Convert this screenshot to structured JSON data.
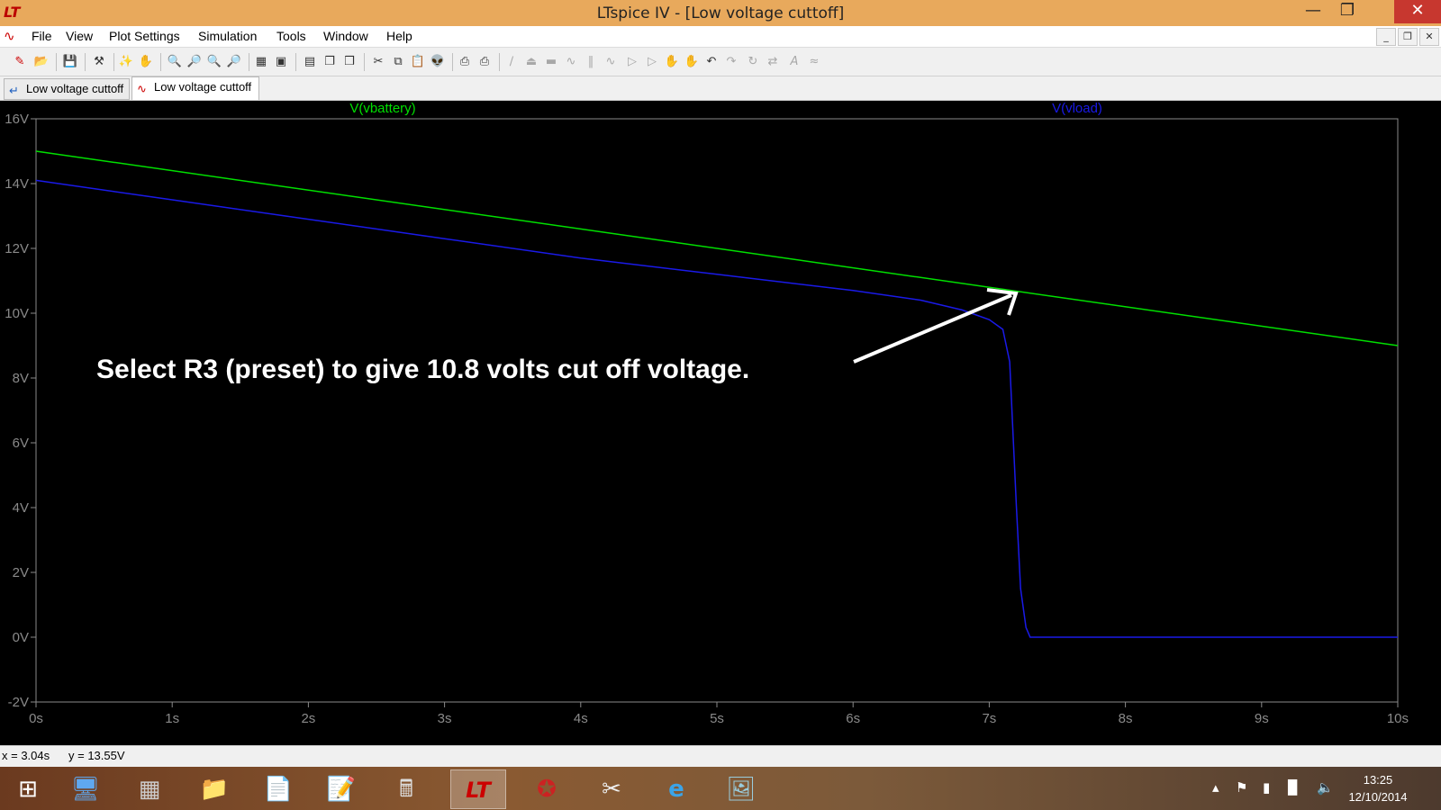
{
  "window": {
    "title": "LTspice IV - [Low voltage cuttoff]",
    "minimize_icon": "minimize-icon",
    "maximize_icon": "restore-icon",
    "close_icon": "close-icon"
  },
  "menu": {
    "items": [
      "File",
      "View",
      "Plot Settings",
      "Simulation",
      "Tools",
      "Window",
      "Help"
    ]
  },
  "tabs": [
    {
      "label": "Low voltage cuttoff",
      "icon": "schematic-icon",
      "active": false
    },
    {
      "label": "Low voltage cuttoff",
      "icon": "waveform-icon",
      "active": true
    }
  ],
  "status": {
    "cursor_x": "x = 3.04s",
    "cursor_y": "y = 13.55V"
  },
  "taskbar": {
    "clock_time": "13:25",
    "clock_date": "12/10/2014"
  },
  "annotation": {
    "text": "Select R3 (preset) to give 10.8 volts cut off voltage."
  },
  "chart_data": {
    "type": "line",
    "xlabel": "",
    "ylabel": "",
    "xlim": [
      0,
      10
    ],
    "ylim": [
      -2,
      16
    ],
    "x_ticks": [
      "0s",
      "1s",
      "2s",
      "3s",
      "4s",
      "5s",
      "6s",
      "7s",
      "8s",
      "9s",
      "10s"
    ],
    "y_ticks": [
      "-2V",
      "0V",
      "2V",
      "4V",
      "6V",
      "8V",
      "10V",
      "12V",
      "14V",
      "16V"
    ],
    "background": "#000000",
    "series": [
      {
        "name": "V(vbattery)",
        "color": "#00e000",
        "x": [
          0,
          10
        ],
        "y": [
          15.0,
          9.0
        ]
      },
      {
        "name": "V(vload)",
        "color": "#1a1ae8",
        "x": [
          0,
          1,
          2,
          3,
          4,
          5,
          6,
          6.5,
          6.8,
          7.0,
          7.1,
          7.15,
          7.2,
          7.23,
          7.27,
          7.3,
          7.4,
          8,
          9,
          10
        ],
        "y": [
          14.1,
          13.5,
          12.9,
          12.3,
          11.7,
          11.2,
          10.7,
          10.4,
          10.1,
          9.8,
          9.5,
          8.5,
          4.0,
          1.5,
          0.3,
          0.0,
          0.0,
          0.0,
          0.0,
          0.0
        ]
      }
    ]
  }
}
